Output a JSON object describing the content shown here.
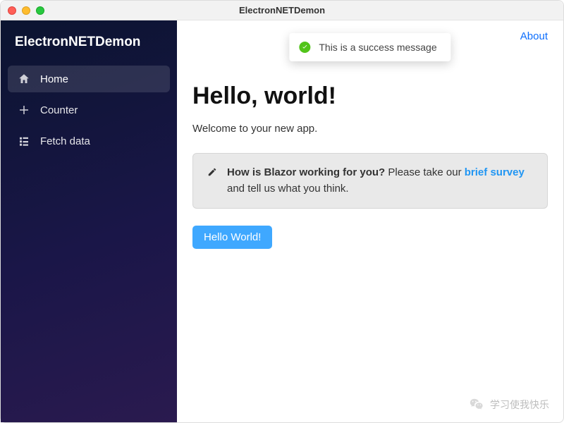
{
  "window": {
    "title": "ElectronNETDemon"
  },
  "brand": "ElectronNETDemon",
  "sidebar": {
    "items": [
      {
        "label": "Home",
        "icon": "home-icon",
        "active": true
      },
      {
        "label": "Counter",
        "icon": "plus-icon",
        "active": false
      },
      {
        "label": "Fetch data",
        "icon": "list-icon",
        "active": false
      }
    ]
  },
  "header": {
    "about": "About"
  },
  "toast": {
    "message": "This is a success message"
  },
  "page": {
    "title": "Hello, world!",
    "welcome": "Welcome to your new app."
  },
  "alert": {
    "bold": "How is Blazor working for you?",
    "before_link": " Please take our ",
    "link": "brief survey",
    "after_link": " and tell us what you think."
  },
  "button": {
    "hello": "Hello World!"
  },
  "watermark": {
    "text": "学习使我快乐"
  }
}
